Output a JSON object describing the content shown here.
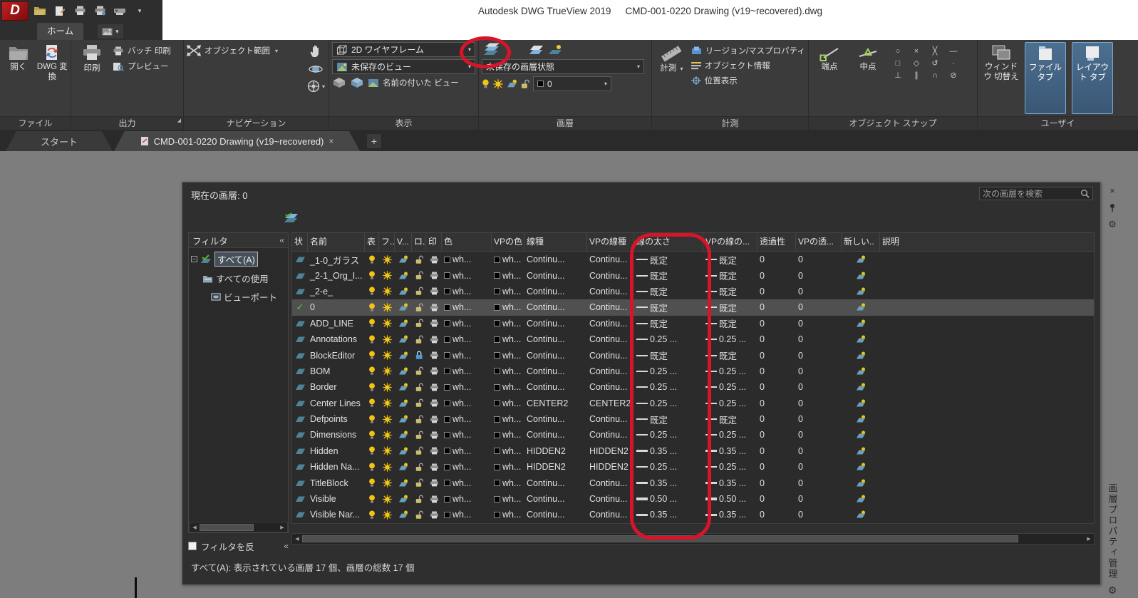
{
  "title_bar": {
    "app": "Autodesk DWG TrueView 2019",
    "doc": "CMD-001-0220 Drawing (v19~recovered).dwg"
  },
  "annotations": {
    "color": "#d8142a"
  },
  "ribbon": {
    "home_tab": "ホーム",
    "file": {
      "label": "ファイル",
      "open": "開く",
      "convert": "DWG 変換"
    },
    "output": {
      "label": "出力",
      "print": "印刷",
      "batch": "バッチ 印刷",
      "preview": "プレビュー"
    },
    "nav": {
      "label": "ナビゲーション",
      "extents": "オブジェクト範囲"
    },
    "view": {
      "label": "表示",
      "style": "2D ワイヤフレーム",
      "unsaved": "未保存のビュー",
      "named": "名前の付いた ビュー"
    },
    "layers": {
      "label": "画層",
      "state": "未保存の画層状態",
      "current": "0"
    },
    "measure": {
      "label": "計測",
      "button": "計測",
      "region": "リージョン/マスプロパティ",
      "objinfo": "オブジェクト情報",
      "locate": "位置表示"
    },
    "osnap": {
      "label": "オブジェクト スナップ",
      "endpoint": "端点",
      "midpoint": "中点",
      "icons": [
        {
          "n": "center",
          "g": "○"
        },
        {
          "n": "node",
          "g": "×"
        },
        {
          "n": "intersection",
          "g": "╳"
        },
        {
          "n": "extension",
          "g": "—"
        },
        {
          "n": "quadrant",
          "g": "□"
        },
        {
          "n": "insertion",
          "g": "◇"
        },
        {
          "n": "geometric-center",
          "g": "↺"
        },
        {
          "n": "nearest",
          "g": "∙"
        },
        {
          "n": "perpendicular",
          "g": "⊥"
        },
        {
          "n": "parallel",
          "g": "∥"
        },
        {
          "n": "tangent",
          "g": "∩"
        },
        {
          "n": "none",
          "g": "⊘"
        }
      ]
    },
    "ui": {
      "label": "ユーザイ",
      "window": "ウィンドウ 切替え",
      "filetab": "ファイル タブ",
      "layouttab": "レイアウト タブ"
    }
  },
  "docbar": {
    "start": "スタート",
    "doc": "CMD-001-0220 Drawing (v19~recovered)",
    "close": "×",
    "add": "+"
  },
  "palette": {
    "current": "現在の画層: 0",
    "search_placeholder": "次の画層を検索",
    "filter": {
      "title": "フィルタ",
      "collapse": "«",
      "all": "すべて(A)",
      "used": "すべての使用",
      "viewport": "ビューポート",
      "invert": "フィルタを反"
    },
    "columns": [
      "状",
      "名前",
      "表",
      "フ..",
      "V...",
      "ロ..",
      "印",
      "色",
      "VPの色",
      "線種",
      "VPの線種",
      "線の太さ",
      "VPの線の...",
      "透過性",
      "VPの透...",
      "新しい..",
      "説明"
    ],
    "rows": [
      {
        "name": "_1-0_ガラス",
        "color": "wh...",
        "lt": "Continu...",
        "vplt": "Continu...",
        "lw": "既定",
        "vplw": "既定",
        "t": "0",
        "vpt": "0",
        "weight": 1
      },
      {
        "name": "_2-1_Org_I...",
        "color": "wh...",
        "lt": "Continu...",
        "vplt": "Continu...",
        "lw": "既定",
        "vplw": "既定",
        "t": "0",
        "vpt": "0",
        "weight": 1
      },
      {
        "name": "_2-e_",
        "color": "wh...",
        "lt": "Continu...",
        "vplt": "Continu...",
        "lw": "既定",
        "vplw": "既定",
        "t": "0",
        "vpt": "0",
        "weight": 1
      },
      {
        "name": "0",
        "current": true,
        "selected": true,
        "color": "wh...",
        "lt": "Continu...",
        "vplt": "Continu...",
        "lw": "既定",
        "vplw": "既定",
        "t": "0",
        "vpt": "0",
        "weight": 1
      },
      {
        "name": "ADD_LINE",
        "color": "wh...",
        "lt": "Continu...",
        "vplt": "Continu...",
        "lw": "既定",
        "vplw": "既定",
        "t": "0",
        "vpt": "0",
        "weight": 1
      },
      {
        "name": "Annotations",
        "color": "wh...",
        "lt": "Continu...",
        "vplt": "Continu...",
        "lw": "0.25 ...",
        "vplw": "0.25 ...",
        "t": "0",
        "vpt": "0",
        "weight": 1
      },
      {
        "name": "BlockEditor",
        "locked": true,
        "color": "wh...",
        "lt": "Continu...",
        "vplt": "Continu...",
        "lw": "既定",
        "vplw": "既定",
        "t": "0",
        "vpt": "0",
        "weight": 1
      },
      {
        "name": "BOM",
        "color": "wh...",
        "lt": "Continu...",
        "vplt": "Continu...",
        "lw": "0.25 ...",
        "vplw": "0.25 ...",
        "t": "0",
        "vpt": "0",
        "weight": 1
      },
      {
        "name": "Border",
        "color": "wh...",
        "lt": "Continu...",
        "vplt": "Continu...",
        "lw": "0.25 ...",
        "vplw": "0.25 ...",
        "t": "0",
        "vpt": "0",
        "weight": 1
      },
      {
        "name": "Center Lines",
        "color": "wh...",
        "lt": "CENTER2",
        "vplt": "CENTER2",
        "lw": "0.25 ...",
        "vplw": "0.25 ...",
        "t": "0",
        "vpt": "0",
        "weight": 1
      },
      {
        "name": "Defpoints",
        "color": "wh...",
        "lt": "Continu...",
        "vplt": "Continu...",
        "lw": "既定",
        "vplw": "既定",
        "t": "0",
        "vpt": "0",
        "weight": 1
      },
      {
        "name": "Dimensions",
        "color": "wh...",
        "lt": "Continu...",
        "vplt": "Continu...",
        "lw": "0.25 ...",
        "vplw": "0.25 ...",
        "t": "0",
        "vpt": "0",
        "weight": 1
      },
      {
        "name": "Hidden",
        "color": "wh...",
        "lt": "HIDDEN2",
        "vplt": "HIDDEN2",
        "lw": "0.35 ...",
        "vplw": "0.35 ...",
        "t": "0",
        "vpt": "0",
        "weight": 2
      },
      {
        "name": "Hidden Na...",
        "color": "wh...",
        "lt": "HIDDEN2",
        "vplt": "HIDDEN2",
        "lw": "0.25 ...",
        "vplw": "0.25 ...",
        "t": "0",
        "vpt": "0",
        "weight": 1
      },
      {
        "name": "TitleBlock",
        "color": "wh...",
        "lt": "Continu...",
        "vplt": "Continu...",
        "lw": "0.35 ...",
        "vplw": "0.35 ...",
        "t": "0",
        "vpt": "0",
        "weight": 2
      },
      {
        "name": "Visible",
        "color": "wh...",
        "lt": "Continu...",
        "vplt": "Continu...",
        "lw": "0.50 ...",
        "vplw": "0.50 ...",
        "t": "0",
        "vpt": "0",
        "weight": 3
      },
      {
        "name": "Visible Nar...",
        "color": "wh...",
        "lt": "Continu...",
        "vplt": "Continu...",
        "lw": "0.35 ...",
        "vplw": "0.35 ...",
        "t": "0",
        "vpt": "0",
        "weight": 2
      }
    ],
    "status": "すべて(A): 表示されている画層 17 個、画層の総数 17 個",
    "side_title": "画層プロパティ管理"
  }
}
